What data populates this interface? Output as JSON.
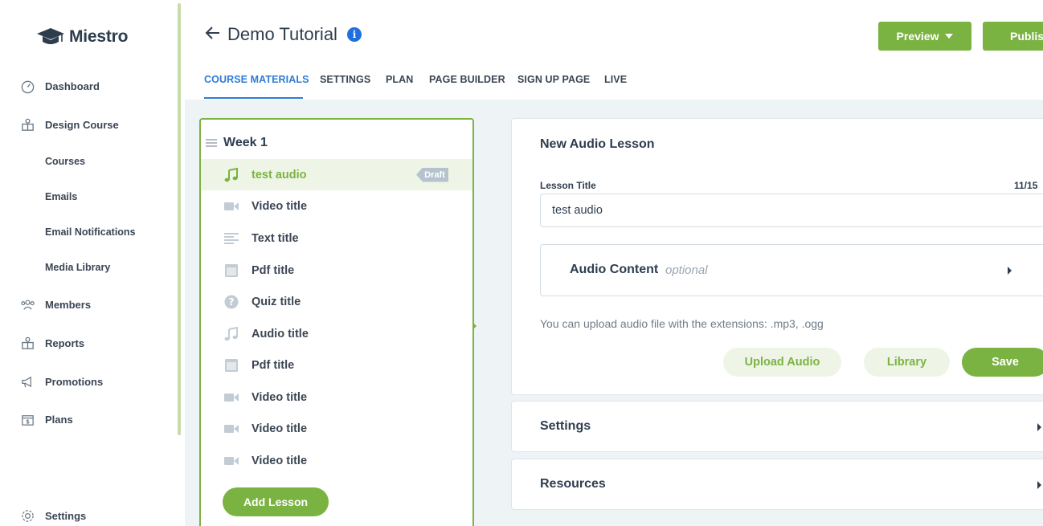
{
  "app": {
    "logo_text": "Miestro",
    "accent_color": "#7bb342",
    "link_color": "#2f7bd6"
  },
  "sidebar": {
    "items": [
      {
        "label": "Dashboard",
        "icon": "dashboard-gauge-icon"
      },
      {
        "label": "Design Course",
        "icon": "design-course-icon"
      },
      {
        "label": "Courses"
      },
      {
        "label": "Emails"
      },
      {
        "label": "Email Notifications"
      },
      {
        "label": "Media Library"
      },
      {
        "label": "Members",
        "icon": "members-icon"
      },
      {
        "label": "Reports",
        "icon": "reports-icon"
      },
      {
        "label": "Promotions",
        "icon": "megaphone-icon"
      },
      {
        "label": "Plans",
        "icon": "plans-icon"
      },
      {
        "label": "Settings",
        "icon": "gear-icon"
      }
    ]
  },
  "header": {
    "title": "Demo Tutorial",
    "info_glyph": "i",
    "preview_label": "Preview",
    "publish_label": "Publish",
    "tabs": [
      {
        "label": "COURSE MATERIALS",
        "active": true
      },
      {
        "label": "SETTINGS"
      },
      {
        "label": "PLAN"
      },
      {
        "label": "PAGE BUILDER"
      },
      {
        "label": "SIGN UP PAGE"
      },
      {
        "label": "LIVE"
      }
    ]
  },
  "lessons": {
    "week_title": "Week 1",
    "items": [
      {
        "title": "test audio",
        "type": "audio",
        "badge": "Draft",
        "active": true
      },
      {
        "title": "Video title",
        "type": "video"
      },
      {
        "title": "Text title",
        "type": "text"
      },
      {
        "title": "Pdf title",
        "type": "pdf"
      },
      {
        "title": "Quiz title",
        "type": "quiz"
      },
      {
        "title": "Audio title",
        "type": "audio"
      },
      {
        "title": "Pdf title",
        "type": "pdf"
      },
      {
        "title": "Video title",
        "type": "video"
      },
      {
        "title": "Video title",
        "type": "video"
      },
      {
        "title": "Video title",
        "type": "video"
      }
    ],
    "add_label": "Add Lesson"
  },
  "editor": {
    "title": "New Audio Lesson",
    "lesson_title_label": "Lesson Title",
    "char_count": "11/15",
    "lesson_title_value": "test audio",
    "audio_content_label": "Audio Content",
    "audio_content_hint": "optional",
    "upload_hint": "You can upload audio file with the extensions: .mp3, .ogg",
    "upload_label": "Upload Audio",
    "library_label": "Library",
    "save_label": "Save"
  },
  "accordions": [
    {
      "label": "Settings"
    },
    {
      "label": "Resources"
    }
  ]
}
